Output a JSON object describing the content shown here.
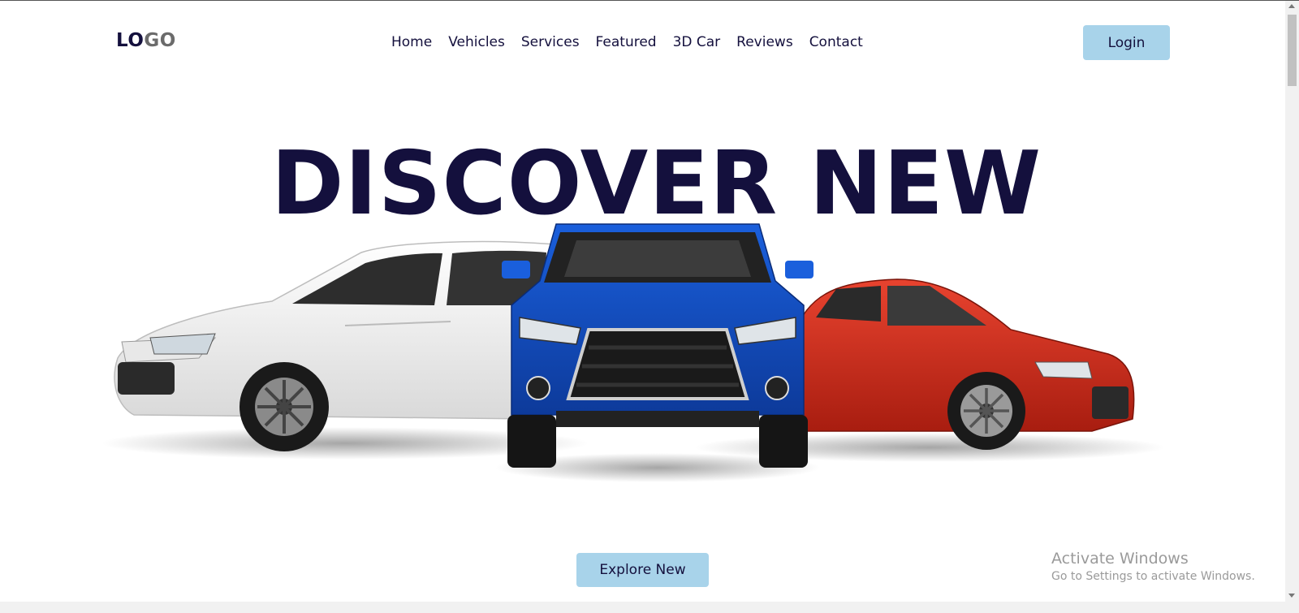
{
  "header": {
    "logo_part1": "LO",
    "logo_part2": "GO",
    "nav": [
      "Home",
      "Vehicles",
      "Services",
      "Featured",
      "3D Car",
      "Reviews",
      "Contact"
    ],
    "login_label": "Login"
  },
  "hero": {
    "title": "DISCOVER NEW",
    "cta_label": "Explore New"
  },
  "watermark": {
    "line1": "Activate Windows",
    "line2": "Go to Settings to activate Windows."
  },
  "colors": {
    "heading": "#14103d",
    "button": "#a8d3ea",
    "car_white": "#f0f0f0",
    "car_blue": "#1550c6",
    "car_red": "#d42a17"
  }
}
